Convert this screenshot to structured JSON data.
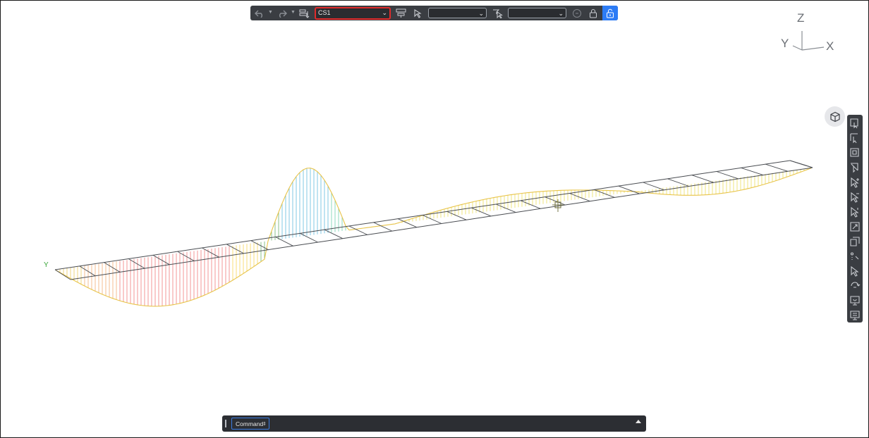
{
  "toolbar": {
    "undo_icon": "undo-icon",
    "redo_icon": "redo-icon",
    "load_case_select": {
      "value": "CS1"
    },
    "select_2": {
      "value": ""
    },
    "select_3": {
      "value": ""
    }
  },
  "axes": {
    "z": "Z",
    "y": "Y",
    "x": "X"
  },
  "model": {
    "y_label": "Y"
  },
  "right_toolbar": {
    "icons": [
      "select-window-icon",
      "select-cross-icon",
      "select-box-icon",
      "select-box-cross-icon",
      "select-pointer-icon",
      "select-plus-icon",
      "select-minus-icon",
      "select-node-icon",
      "select-element-icon",
      "select-grid-icon",
      "select-axis-icon",
      "rotate-icon",
      "display-icon",
      "display-settings-icon"
    ]
  },
  "command": {
    "label": "Command"
  },
  "colors": {
    "toolbar_bg": "#3a3d42",
    "accent_blue": "#2d7cf5",
    "highlight_red": "#e02b2b"
  }
}
